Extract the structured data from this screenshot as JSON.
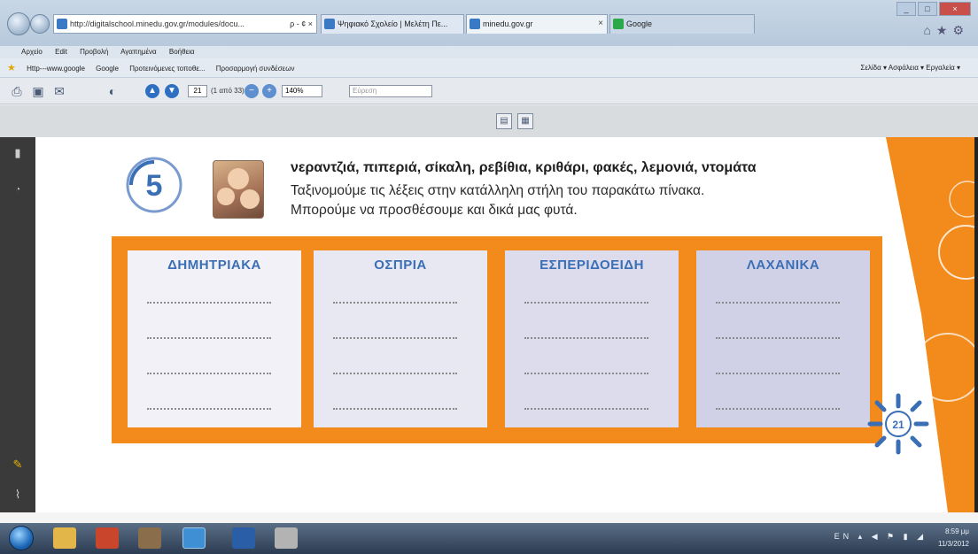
{
  "browser": {
    "address": "http://digitalschool.minedu.gov.gr/modules/docu...",
    "address_controls": "ρ - ¢ ×",
    "tabs": [
      {
        "label": "Ψηφιακό Σχολείο | Μελέτη Πε..."
      },
      {
        "label": "minedu.gov.gr"
      },
      {
        "label": "Google"
      }
    ],
    "window_controls": [
      "_",
      "□",
      "×"
    ],
    "menu": [
      "Αρχείο",
      "Edit",
      "Προβολή",
      "Αγαπημένα",
      "Βοήθεια"
    ],
    "favorites": [
      "Http---www.google",
      "Google",
      "Προτεινόμενες τοποθε...",
      "Προσαρμογή συνδέσεων"
    ],
    "favbar_right": "Σελίδα ▾  Ασφάλεια ▾  Εργαλεία ▾"
  },
  "pdf_toolbar": {
    "page": "21",
    "page_count": "(1 από 33)",
    "zoom": "140%",
    "find_placeholder": "Εύρεση"
  },
  "exercise": {
    "number": "5",
    "words": "νεραντζιά, πιπεριά, σίκαλη, ρεβίθια, κριθάρι, φακές, λεμονιά, ντομάτα",
    "instruction_1": "Ταξινομούμε τις λέξεις στην κατάλληλη στήλη του παρακάτω πίνακα.",
    "instruction_2": "Μπορούμε να προσθέσουμε και δικά μας φυτά.",
    "columns": [
      {
        "title": "ΔΗΜΗΤΡΙΑΚΑ"
      },
      {
        "title": "ΟΣΠΡΙΑ"
      },
      {
        "title": "ΕΣΠΕΡΙΔΟΕΙΔΗ"
      },
      {
        "title": "ΛΑΧΑΝΙΚΑ"
      }
    ],
    "page_number": "21"
  },
  "taskbar": {
    "language": "EN",
    "time": "8:59 μμ",
    "date": "11/3/2012"
  },
  "colors": {
    "orange": "#f28a1c",
    "column_title_blue": "#3a6fb6"
  }
}
